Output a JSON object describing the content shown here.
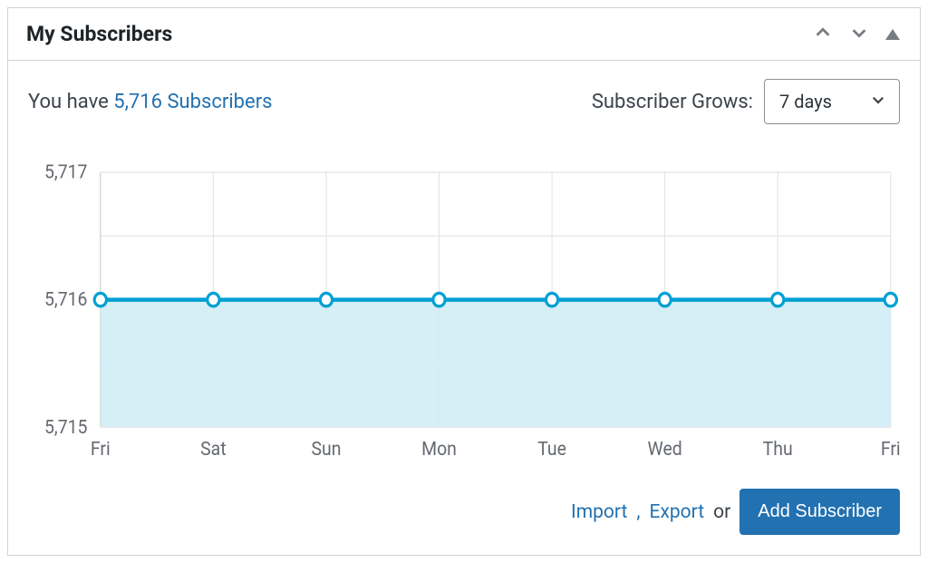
{
  "panel": {
    "title": "My Subscribers"
  },
  "summary": {
    "prefix": "You have ",
    "link_text": "5,716 Subscribers"
  },
  "grows": {
    "label": "Subscriber Grows:",
    "selected": "7 days"
  },
  "chart_data": {
    "type": "area",
    "categories": [
      "Fri",
      "Sat",
      "Sun",
      "Mon",
      "Tue",
      "Wed",
      "Thu",
      "Fri"
    ],
    "values": [
      5716,
      5716,
      5716,
      5716,
      5716,
      5716,
      5716,
      5716
    ],
    "y_ticks": [
      5715,
      5716,
      5717
    ],
    "ylim": [
      5715,
      5717
    ],
    "xlabel": "",
    "ylabel": "",
    "title": ""
  },
  "footer": {
    "import": "Import",
    "export": "Export",
    "separator": ", ",
    "or": " or ",
    "add_button": "Add Subscriber"
  }
}
